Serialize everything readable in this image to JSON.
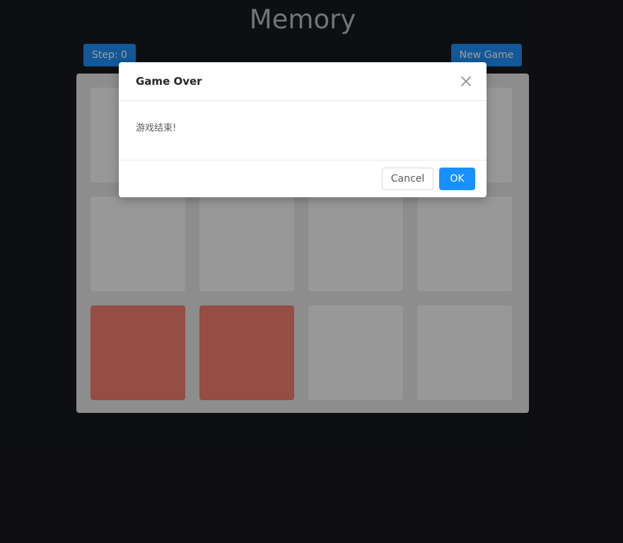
{
  "app": {
    "title": "Memory"
  },
  "toolbar": {
    "step_label": "Step: 0",
    "new_game_label": "New Game"
  },
  "board": {
    "rows": 3,
    "cols": 4,
    "revealed_cards": [
      8,
      9
    ],
    "colors": {
      "board_bg": "#e4e4e4",
      "card_hidden": "#f6f6f6",
      "card_revealed": "#f37c6d"
    }
  },
  "modal": {
    "title": "Game Over",
    "message": "游戏结束!",
    "cancel_label": "Cancel",
    "ok_label": "OK",
    "close_icon": "close-icon"
  },
  "colors": {
    "page_bg": "#18191e",
    "accent": "#1890ff"
  }
}
